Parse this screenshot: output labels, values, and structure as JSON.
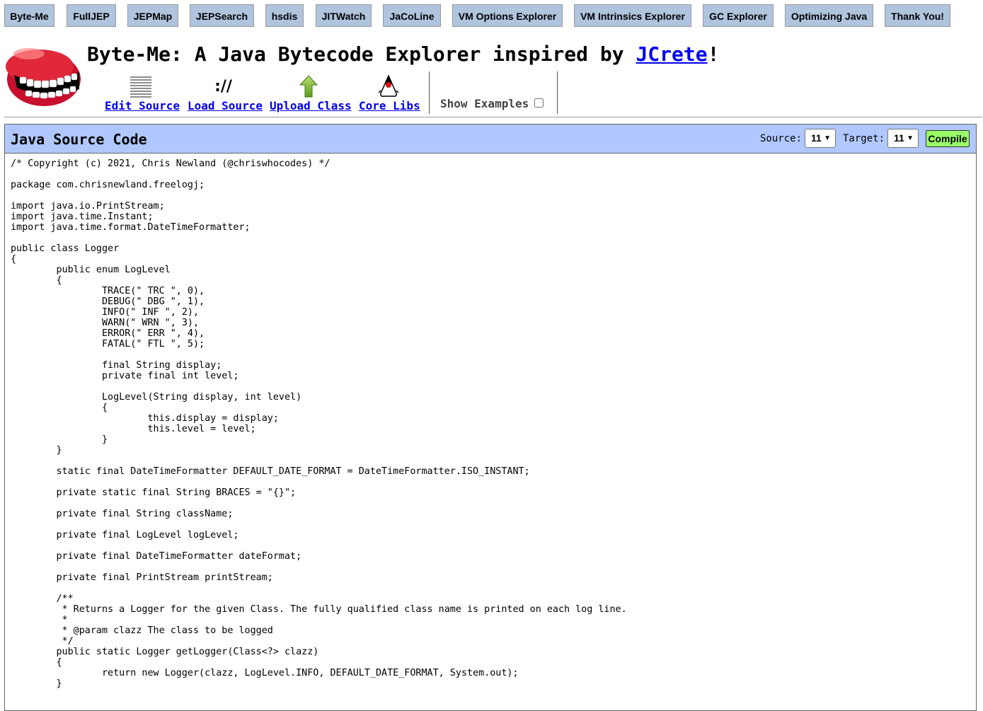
{
  "nav": [
    {
      "id": "byte-me",
      "label": "Byte-Me"
    },
    {
      "id": "fulljep",
      "label": "FullJEP"
    },
    {
      "id": "jepmap",
      "label": "JEPMap"
    },
    {
      "id": "jepsearch",
      "label": "JEPSearch"
    },
    {
      "id": "hsdis",
      "label": "hsdis"
    },
    {
      "id": "jitwatch",
      "label": "JITWatch"
    },
    {
      "id": "jacoline",
      "label": "JaCoLine"
    },
    {
      "id": "vm-options-explorer",
      "label": "VM Options Explorer"
    },
    {
      "id": "vm-intrinsics-explorer",
      "label": "VM Intrinsics Explorer"
    },
    {
      "id": "gc-explorer",
      "label": "GC Explorer"
    },
    {
      "id": "optimizing-java",
      "label": "Optimizing Java"
    },
    {
      "id": "thank-you",
      "label": "Thank You!"
    }
  ],
  "header": {
    "title_prefix": "Byte-Me: A Java Bytecode Explorer inspired by ",
    "title_link": "JCrete",
    "title_suffix": "!"
  },
  "toolbar": {
    "edit_source": "Edit Source",
    "load_source_icon_text": "://",
    "load_source": "Load Source",
    "upload_class": "Upload Class",
    "core_libs": "Core Libs",
    "show_examples": "Show Examples",
    "show_examples_checked": false
  },
  "panel": {
    "title": "Java Source Code",
    "source_label": "Source:",
    "source_value": "11",
    "target_label": "Target:",
    "target_value": "11",
    "compile_label": "Compile",
    "accent": "#b0c8ff",
    "compile_color": "#99ff66"
  },
  "code": "/* Copyright (c) 2021, Chris Newland (@chriswhocodes) */\n\npackage com.chrisnewland.freelogj;\n\nimport java.io.PrintStream;\nimport java.time.Instant;\nimport java.time.format.DateTimeFormatter;\n\npublic class Logger\n{\n\tpublic enum LogLevel\n\t{\n\t\tTRACE(\" TRC \", 0),\n\t\tDEBUG(\" DBG \", 1),\n\t\tINFO(\" INF \", 2),\n\t\tWARN(\" WRN \", 3),\n\t\tERROR(\" ERR \", 4),\n\t\tFATAL(\" FTL \", 5);\n\n\t\tfinal String display;\n\t\tprivate final int level;\n\n\t\tLogLevel(String display, int level)\n\t\t{\n\t\t\tthis.display = display;\n\t\t\tthis.level = level;\n\t\t}\n\t}\n\n\tstatic final DateTimeFormatter DEFAULT_DATE_FORMAT = DateTimeFormatter.ISO_INSTANT;\n\n\tprivate static final String BRACES = \"{}\";\n\n\tprivate final String className;\n\n\tprivate final LogLevel logLevel;\n\n\tprivate final DateTimeFormatter dateFormat;\n\n\tprivate final PrintStream printStream;\n\n\t/**\n\t * Returns a Logger for the given Class. The fully qualified class name is printed on each log line.\n\t *\n\t * @param clazz The class to be logged\n\t */\n\tpublic static Logger getLogger(Class<?> clazz)\n\t{\n\t\treturn new Logger(clazz, LogLevel.INFO, DEFAULT_DATE_FORMAT, System.out);\n\t}"
}
